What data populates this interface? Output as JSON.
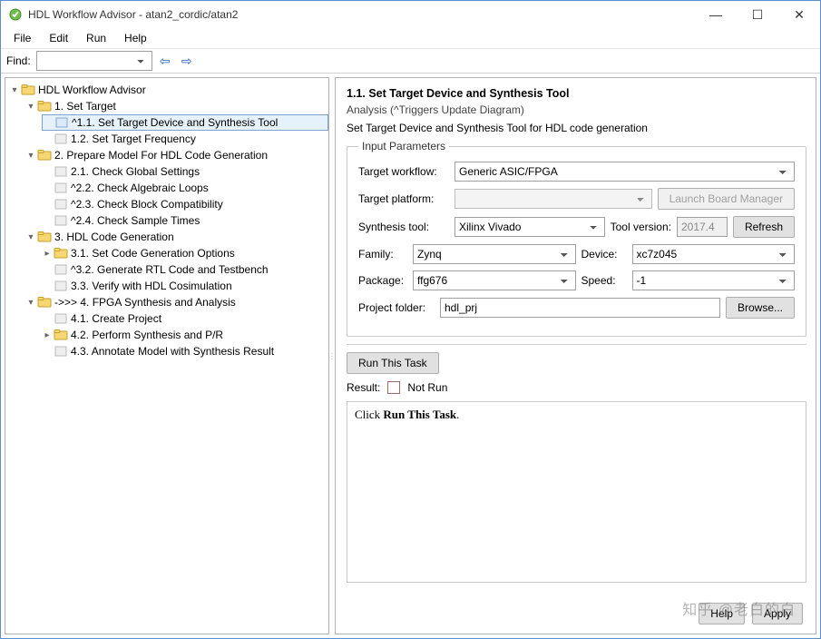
{
  "window": {
    "title": "HDL Workflow Advisor - atan2_cordic/atan2",
    "min_icon": "—",
    "max_icon": "☐",
    "close_icon": "✕"
  },
  "menu": {
    "file": "File",
    "edit": "Edit",
    "run": "Run",
    "help": "Help"
  },
  "findbar": {
    "label": "Find:"
  },
  "tree": {
    "root": "HDL Workflow Advisor",
    "n1": "1. Set Target",
    "n11": "^1.1. Set Target Device and Synthesis Tool",
    "n12": "1.2. Set Target Frequency",
    "n2": "2. Prepare Model For HDL Code Generation",
    "n21": "2.1. Check Global Settings",
    "n22": "^2.2. Check Algebraic Loops",
    "n23": "^2.3. Check Block Compatibility",
    "n24": "^2.4. Check Sample Times",
    "n3": "3. HDL Code Generation",
    "n31": "3.1. Set Code Generation Options",
    "n32": "^3.2. Generate RTL Code and Testbench",
    "n33": "3.3. Verify with HDL Cosimulation",
    "n4": "->>> 4. FPGA Synthesis and Analysis",
    "n41": "4.1. Create Project",
    "n42": "4.2. Perform Synthesis and P/R",
    "n43": "4.3. Annotate Model with Synthesis Result"
  },
  "panel": {
    "title": "1.1. Set Target Device and Synthesis Tool",
    "analysis": "Analysis (^Triggers Update Diagram)",
    "desc": "Set Target Device and Synthesis Tool for HDL code generation",
    "legend": "Input Parameters",
    "labels": {
      "workflow": "Target workflow:",
      "platform": "Target platform:",
      "synth": "Synthesis tool:",
      "toolver": "Tool version:",
      "family": "Family:",
      "device": "Device:",
      "package": "Package:",
      "speed": "Speed:",
      "projfolder": "Project folder:"
    },
    "values": {
      "workflow": "Generic ASIC/FPGA",
      "platform": "",
      "synth": "Xilinx Vivado",
      "toolver": "2017.4",
      "family": "Zynq",
      "device": "xc7z045",
      "package": "ffg676",
      "speed": "-1",
      "projfolder": "hdl_prj"
    },
    "buttons": {
      "launch": "Launch Board Manager",
      "refresh": "Refresh",
      "browse": "Browse...",
      "run": "Run This Task",
      "help": "Help",
      "apply": "Apply"
    },
    "result_label": "Result:",
    "result_value": "Not Run",
    "hint_prefix": "Click ",
    "hint_bold": "Run This Task",
    "hint_suffix": "."
  },
  "watermark": "知乎 @老白的白"
}
